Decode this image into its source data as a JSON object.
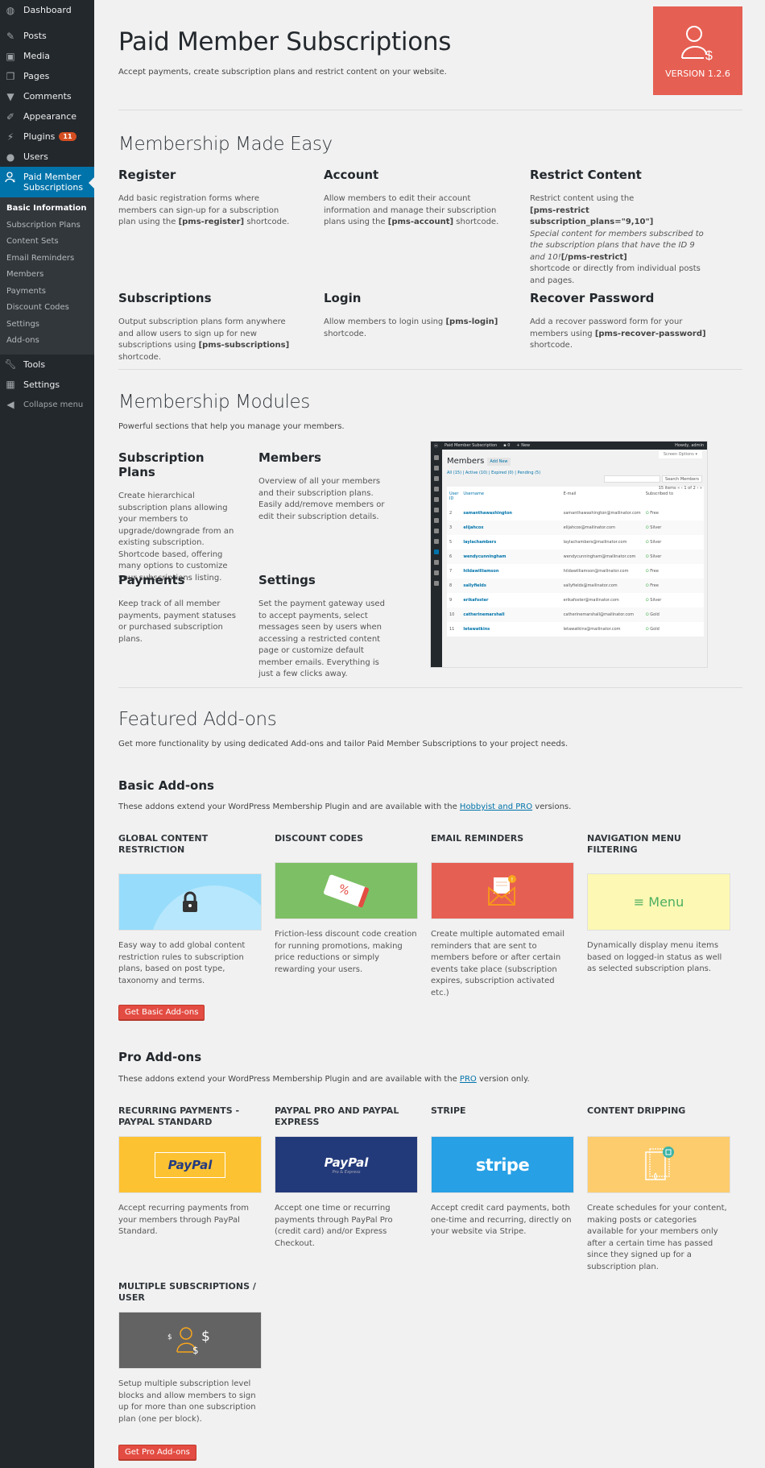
{
  "sidebar": {
    "top_items": [
      {
        "label": "Dashboard",
        "icon": "dashboard-icon"
      },
      {
        "label": "Posts",
        "icon": "pin-icon"
      },
      {
        "label": "Media",
        "icon": "media-icon"
      },
      {
        "label": "Pages",
        "icon": "pages-icon"
      },
      {
        "label": "Comments",
        "icon": "comment-icon"
      },
      {
        "label": "Appearance",
        "icon": "brush-icon"
      },
      {
        "label": "Plugins",
        "icon": "plugin-icon",
        "badge": "11"
      },
      {
        "label": "Users",
        "icon": "user-icon"
      }
    ],
    "active_item": {
      "label": "Paid Member Subscriptions",
      "icon": "member-dollar-icon"
    },
    "submenu": [
      {
        "label": "Basic Information",
        "current": true
      },
      {
        "label": "Subscription Plans"
      },
      {
        "label": "Content Sets"
      },
      {
        "label": "Email Reminders"
      },
      {
        "label": "Members"
      },
      {
        "label": "Payments"
      },
      {
        "label": "Discount Codes"
      },
      {
        "label": "Settings"
      },
      {
        "label": "Add-ons"
      }
    ],
    "bottom_items": [
      {
        "label": "Tools",
        "icon": "wrench-icon"
      },
      {
        "label": "Settings",
        "icon": "settings-icon"
      }
    ],
    "collapse_label": "Collapse menu"
  },
  "header": {
    "title": "Paid Member Subscriptions",
    "subtitle": "Accept payments, create subscription plans and restrict content on your website.",
    "version_label": "VERSION 1.2.6",
    "brand_color": "#e65f53"
  },
  "made_easy": {
    "title": "Membership Made Easy",
    "features": [
      {
        "title": "Register",
        "pre": "Add basic registration forms where members can sign-up for a subscription plan using the ",
        "code": "[pms-register]",
        "post": " shortcode."
      },
      {
        "title": "Account",
        "pre": "Allow members to edit their account information and manage their subscription plans using the ",
        "code": "[pms-account]",
        "post": " shortcode."
      },
      {
        "title": "Restrict Content",
        "pre": "Restrict content using the",
        "code": "[pms-restrict subscription_plans=\"9,10\"]",
        "italic": "Special content for members subscribed to the subscription plans that have the ID 9 and 10!",
        "code2": "[/pms-restrict]",
        "post": "shortcode or directly from individual posts and pages."
      },
      {
        "title": "Subscriptions",
        "pre": "Output subscription plans form anywhere and allow users to sign up for new subscriptions using ",
        "code": "[pms-subscriptions]",
        "post": " shortcode."
      },
      {
        "title": "Login",
        "pre": "Allow members to login using ",
        "code": "[pms-login]",
        "post": " shortcode."
      },
      {
        "title": "Recover Password",
        "pre": "Add a recover password form for your members using ",
        "code": "[pms-recover-password]",
        "post": " shortcode."
      }
    ]
  },
  "modules": {
    "title": "Membership Modules",
    "lead": "Powerful sections that help you manage your members.",
    "items": [
      {
        "title": "Subscription Plans",
        "text": "Create hierarchical subscription plans allowing your members to upgrade/downgrade from an existing subscription. Shortcode based, offering many options to customize your subscriptions listing."
      },
      {
        "title": "Members",
        "text": "Overview of all your members and their subscription plans. Easily add/remove members or edit their subscription details."
      },
      {
        "title": "Payments",
        "text": "Keep track of all member payments, payment statuses or purchased subscription plans."
      },
      {
        "title": "Settings",
        "text": "Set the payment gateway used to accept payments, select messages seen by users when accessing a restricted content page or customize default member emails. Everything is just a few clicks away."
      }
    ],
    "screenshot": {
      "topbar_site": "Paid Member Subscription",
      "topbar_comments": "0",
      "topbar_new": "+ New",
      "topbar_user": "Howdy, admin",
      "screen_options": "Screen Options ▾",
      "title": "Members",
      "add_new": "Add New",
      "filters": "All (15) | Active (10) | Expired (0) | Pending (5)",
      "search_button": "Search Members",
      "pagination": "15 items « ‹ 1 of 2 › »",
      "columns": [
        "User ID",
        "Username",
        "E-mail",
        "Subscribed to"
      ],
      "rows": [
        {
          "id": "2",
          "username": "samanthawashington",
          "email": "samanthawashington@mailinator.com",
          "plan": "Free"
        },
        {
          "id": "3",
          "username": "elijahcox",
          "email": "elijahcox@mailinator.com",
          "plan": "Silver"
        },
        {
          "id": "5",
          "username": "laylachambers",
          "email": "laylachambers@mailinator.com",
          "plan": "Silver"
        },
        {
          "id": "6",
          "username": "wendycunningham",
          "email": "wendycunningham@mailinator.com",
          "plan": "Silver"
        },
        {
          "id": "7",
          "username": "hildawilliamson",
          "email": "hildawilliamson@mailinator.com",
          "plan": "Free"
        },
        {
          "id": "8",
          "username": "sallyfields",
          "email": "sallyfields@mailinator.com",
          "plan": "Free"
        },
        {
          "id": "9",
          "username": "erikafoster",
          "email": "erikafoster@mailinator.com",
          "plan": "Silver"
        },
        {
          "id": "10",
          "username": "catherinemarshall",
          "email": "catherinemarshall@mailinator.com",
          "plan": "Gold"
        },
        {
          "id": "11",
          "username": "letawatkins",
          "email": "letawatkins@mailinator.com",
          "plan": "Gold"
        }
      ]
    }
  },
  "addons": {
    "title": "Featured Add-ons",
    "lead": "Get more functionality by using dedicated Add-ons and tailor Paid Member Subscriptions to your project needs.",
    "basic": {
      "title": "Basic Add-ons",
      "lead_pre": "These addons extend your WordPress Membership Plugin and are available with the ",
      "lead_link": "Hobbyist and PRO",
      "lead_post": " versions.",
      "button": "Get Basic Add-ons",
      "items": [
        {
          "title": "GLOBAL CONTENT RESTRICTION",
          "text": "Easy way to add global content restriction rules to subscription plans, based on post type, taxonomy and terms.",
          "color": "#97dcfb",
          "icon": "lock-globe-icon"
        },
        {
          "title": "DISCOUNT CODES",
          "text": "Friction-less discount code creation for running promotions, making price reductions or simply rewarding your users.",
          "color": "#7dbf65",
          "icon": "discount-tag-icon",
          "glyph": "%"
        },
        {
          "title": "EMAIL REMINDERS",
          "text": "Create multiple automated email reminders that are sent to members before or after certain events take place (subscription expires, subscription activated etc.)",
          "color": "#e65f53",
          "icon": "envelope-icon"
        },
        {
          "title": "NAVIGATION MENU FILTERING",
          "text": "Dynamically display menu items based on logged-in status as well as selected subscription plans.",
          "color": "#fdf8b3",
          "icon": "menu-icon",
          "glyph": "Menu"
        }
      ]
    },
    "pro": {
      "title": "Pro Add-ons",
      "lead_pre": "These addons extend your WordPress Membership Plugin and are available with the ",
      "lead_link": "PRO",
      "lead_post": " version only.",
      "button": "Get Pro Add-ons",
      "items": [
        {
          "title": "RECURRING PAYMENTS - PAYPAL STANDARD",
          "text": "Accept recurring payments from your members through PayPal Standard.",
          "color": "#fdc232",
          "icon": "paypal-recurring-icon",
          "glyph": "PayPal"
        },
        {
          "title": "PAYPAL PRO AND PAYPAL EXPRESS",
          "text": "Accept one time or recurring payments through PayPal Pro (credit card) and/or Express Checkout.",
          "color": "#233a7a",
          "icon": "paypal-pro-icon",
          "glyph": "PayPal",
          "glyph_sub": "Pro & Express"
        },
        {
          "title": "STRIPE",
          "text": "Accept credit card payments, both one-time and recurring, directly on your website via Stripe.",
          "color": "#27a0e5",
          "icon": "stripe-icon",
          "glyph": "stripe"
        },
        {
          "title": "CONTENT DRIPPING",
          "text": "Create schedules for your content, making posts or categories available for your members only after a certain time has passed since they signed up for a subscription plan.",
          "color": "#fdcc6d",
          "icon": "content-drip-icon"
        },
        {
          "title": "MULTIPLE SUBSCRIPTIONS / USER",
          "text": "Setup multiple subscription level blocks and allow members to sign up for more than one subscription plan (one per block).",
          "color": "#636363",
          "icon": "multi-subscription-icon"
        }
      ]
    }
  }
}
